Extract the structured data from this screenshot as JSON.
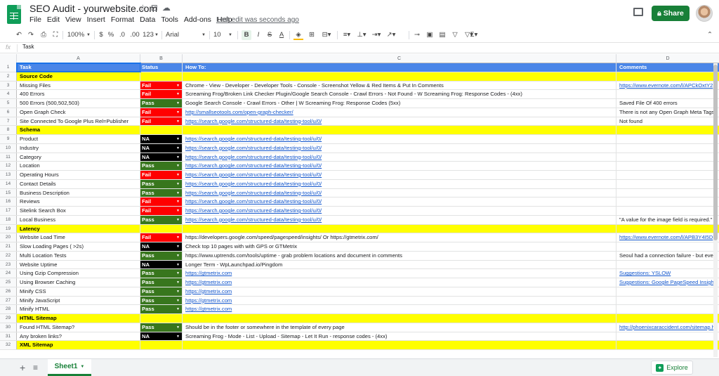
{
  "title": {
    "doc_name": "SEO Audit - yourwebsite.com",
    "star_icon": "☆",
    "move_icon": "⊡",
    "cloud_icon": "☁"
  },
  "menu": [
    "File",
    "Edit",
    "View",
    "Insert",
    "Format",
    "Data",
    "Tools",
    "Add-ons",
    "Help"
  ],
  "last_edit": "Last edit was seconds ago",
  "share_label": "Share",
  "toolbar": {
    "undo": "↶",
    "redo": "↷",
    "print": "⎙",
    "paint": "⛶",
    "zoom": "100%",
    "currency": "$",
    "percent": "%",
    "dec_less": ".0",
    "dec_more": ".00",
    "more_formats": "123",
    "font": "Arial",
    "font_size": "10",
    "bold": "B",
    "italic": "I",
    "strike": "S",
    "text_color": "A"
  },
  "formula_bar": {
    "fx": "fx",
    "value": "Task"
  },
  "columns": [
    "A",
    "B",
    "C",
    "D"
  ],
  "header_row": {
    "task": "Task",
    "status": "Status",
    "howto": "How To:",
    "comments": "Comments"
  },
  "rows": [
    {
      "n": "2",
      "type": "sec",
      "a": "Source Code"
    },
    {
      "n": "3",
      "a": "Missing Files",
      "b": "Fail",
      "c": "Chrome - View - Developer - Developer Tools - Console - Screenshot Yellow & Red Items & Put In Comments",
      "d": "https://www.evernote.com/l/APCkOxtY2",
      "dlink": true
    },
    {
      "n": "4",
      "a": "400 Errors",
      "b": "Fail",
      "c": "Screaming Frog/Broken Link Checker Plugin/Google Search Console - Crawl Errors - Not Found - W Screaming Frog: Response Codes - (4xx)",
      "d": ""
    },
    {
      "n": "5",
      "a": "500 Errors (500,502,503)",
      "b": "Pass",
      "c": "Google Search Console - Crawl Errors - Other  | W Screaming Frog: Response Codes (5xx)",
      "d": "Saved File Of 400 errors"
    },
    {
      "n": "6",
      "a": "Open Graph Check",
      "b": "Fail",
      "c": "http://smallseotools.com/open-graph-checker/",
      "clink": true,
      "d": "There is not any Open Graph Meta Tags"
    },
    {
      "n": "7",
      "a": "Site Connected To Google Plus Rel=Publisher",
      "b": "Fail",
      "c": "https://search.google.com/structured-data/testing-tool/u/0/",
      "clink": true,
      "d": "Not found"
    },
    {
      "n": "8",
      "type": "sec",
      "a": "Schema"
    },
    {
      "n": "9",
      "a": "Product",
      "b": "NA",
      "c": "https://search.google.com/structured-data/testing-tool/u/0/",
      "clink": true,
      "d": ""
    },
    {
      "n": "10",
      "a": "Industry",
      "b": "NA",
      "c": "https://search.google.com/structured-data/testing-tool/u/0/",
      "clink": true,
      "d": ""
    },
    {
      "n": "11",
      "a": "Category",
      "b": "NA",
      "c": "https://search.google.com/structured-data/testing-tool/u/0/",
      "clink": true,
      "d": ""
    },
    {
      "n": "12",
      "a": "Location",
      "b": "Pass",
      "c": "https://search.google.com/structured-data/testing-tool/u/0/",
      "clink": true,
      "d": ""
    },
    {
      "n": "13",
      "a": "Operating Hours",
      "b": "Fail",
      "c": "https://search.google.com/structured-data/testing-tool/u/0/",
      "clink": true,
      "d": ""
    },
    {
      "n": "14",
      "a": "Contact Details",
      "b": "Pass",
      "c": "https://search.google.com/structured-data/testing-tool/u/0/",
      "clink": true,
      "d": ""
    },
    {
      "n": "15",
      "a": "Business Description",
      "b": "Pass",
      "c": "https://search.google.com/structured-data/testing-tool/u/0/",
      "clink": true,
      "d": ""
    },
    {
      "n": "16",
      "a": "Reviews",
      "b": "Fail",
      "c": "https://search.google.com/structured-data/testing-tool/u/0/",
      "clink": true,
      "d": ""
    },
    {
      "n": "17",
      "a": "Sitelink Search Box",
      "b": "Fail",
      "c": "https://search.google.com/structured-data/testing-tool/u/0/",
      "clink": true,
      "d": ""
    },
    {
      "n": "18",
      "a": "Local Business",
      "b": "Pass",
      "c": "https://search.google.com/structured-data/testing-tool/u/0/",
      "clink": true,
      "d": "\"A value for the image field is required.\""
    },
    {
      "n": "19",
      "type": "sec",
      "a": "Latency"
    },
    {
      "n": "20",
      "a": "Website Load Time",
      "b": "Fail",
      "c": "https://developers.google.com/speed/pagespeed/insights/ Or https://gtmetrix.com/",
      "d": "https://www.evernote.com/l/APB3Y4I5D",
      "dlink": true
    },
    {
      "n": "21",
      "a": "Slow Loading Pages ( >2s)",
      "b": "NA",
      "c": "Check top 10 pages with with GPS or GTMetrix",
      "d": ""
    },
    {
      "n": "22",
      "a": "Multi Location Tests",
      "b": "Pass",
      "c": "https://www.uptrends.com/tools/uptime - grab problem locations and document in comments",
      "d": "Seoul had a connection failure - but eve"
    },
    {
      "n": "23",
      "a": "Website Uptime",
      "b": "NA",
      "c": "Longer Term - WpLaunchpad.io/Pingdom",
      "d": ""
    },
    {
      "n": "24",
      "a": "Using Gzip Compression",
      "b": "Pass",
      "c": "https://gtmetrix.com",
      "clink": true,
      "d": "Suggestions: YSLOW",
      "dlink": true
    },
    {
      "n": "25",
      "a": "Using Browser Caching",
      "b": "Pass",
      "c": "https://gtmetrix.com",
      "clink": true,
      "d": "Suggestions: Google PageSpeed Insigh",
      "dlink": true
    },
    {
      "n": "26",
      "a": "Minify CSS",
      "b": "Pass",
      "c": "https://gtmetrix.com",
      "clink": true,
      "d": ""
    },
    {
      "n": "27",
      "a": "Minify JavaScript",
      "b": "Pass",
      "c": "https://gtmetrix.com",
      "clink": true,
      "d": ""
    },
    {
      "n": "28",
      "a": "Minify HTML",
      "b": "Pass",
      "c": "https://gtmetrix.com",
      "clink": true,
      "d": ""
    },
    {
      "n": "29",
      "type": "sec",
      "a": "HTML Sitemap"
    },
    {
      "n": "30",
      "a": "Found HTML Sitemap?",
      "b": "Pass",
      "c": "Should be in the footer or somewhere in the template of every page",
      "d": "http://phoenixcaraccident.com/sitemap.h",
      "dlink": true
    },
    {
      "n": "31",
      "a": "Any broken links?",
      "b": "NA",
      "c": "Screaming Frog - Mode - List - Upload - Sitemap - Let It Run - response codes - (4xx)",
      "d": ""
    },
    {
      "n": "32",
      "type": "sec",
      "a": "XML Sitemap"
    }
  ],
  "status_colors": {
    "Fail": "#ff0000",
    "Pass": "#38761d",
    "NA": "#000000"
  },
  "bottom": {
    "add_icon": "+",
    "list_icon": "≡",
    "sheet_name": "Sheet1",
    "explore": "Explore"
  }
}
